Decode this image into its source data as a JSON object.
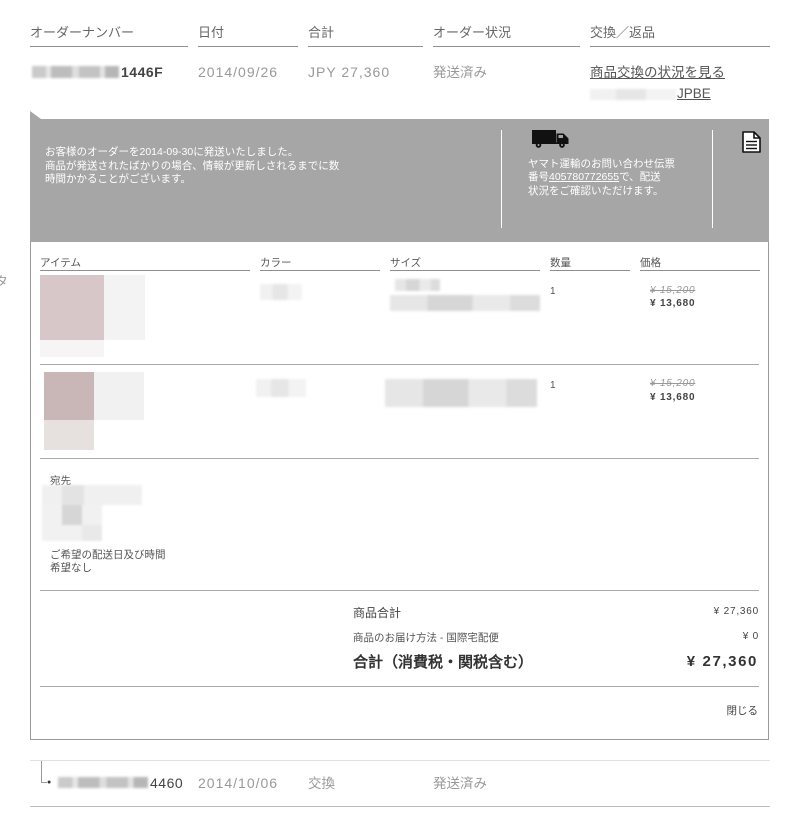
{
  "table_header": {
    "order_number": "オーダーナンバー",
    "date": "日付",
    "total": "合計",
    "status": "オーダー状況",
    "exchange_return": "交換／返品"
  },
  "orders": [
    {
      "number_visible": "1446F",
      "date": "2014/09/26",
      "total": "JPY 27,360",
      "status": "発送済み",
      "exchange_link": "商品交換の状況を見る",
      "exchange_ref_visible": "JPBE"
    },
    {
      "bullet": "●",
      "number_visible": "4460",
      "date": "2014/10/06",
      "total": "交換",
      "status": "発送済み"
    }
  ],
  "order_detail": {
    "shipping_notice": [
      "お客様のオーダーを2014-09-30に発送いたしました。",
      "商品が発送されたばかりの場合、情報が更新しされるまでに数",
      "時間かかることがございます。"
    ],
    "tracking": {
      "line1": "ヤマト運輸のお問い合わせ伝票",
      "line2_prefix": "番号",
      "number": "405780772655",
      "line2_suffix": "で、配送",
      "line3": "状況をご確認いただけます。"
    },
    "icons": {
      "shipping": "truck-icon",
      "document": "document-icon"
    },
    "item_headers": {
      "item": "アイテム",
      "color": "カラー",
      "size": "サイズ",
      "quantity": "数量",
      "price": "価格"
    },
    "items": [
      {
        "quantity": "1",
        "original_price": "¥ 15,200",
        "sale_price": "¥ 13,680"
      },
      {
        "quantity": "1",
        "original_price": "¥ 15,200",
        "sale_price": "¥ 13,680"
      }
    ],
    "delivery": {
      "address_label": "宛先",
      "preference_label": "ご希望の配送日及び時間",
      "preference_value": "希望なし"
    },
    "totals": {
      "subtotal_label": "商品合計",
      "subtotal": "¥ 27,360",
      "shipping_label": "商品のお届け方法 - 国際宅配便",
      "shipping": "¥ 0",
      "grand_total_label": "合計（消費税・関税含む）",
      "grand_total": "¥ 27,360"
    },
    "close_label": "閉じる"
  },
  "edge_fragment": "タ",
  "colors": {
    "banner": "#a6a6a6",
    "banner_text": "#ffffff",
    "panel_border": "#9b9b9b",
    "rule": "#8f8f8f",
    "text": "#555555",
    "muted": "#999999",
    "strong": "#444444",
    "link": "#555555"
  }
}
